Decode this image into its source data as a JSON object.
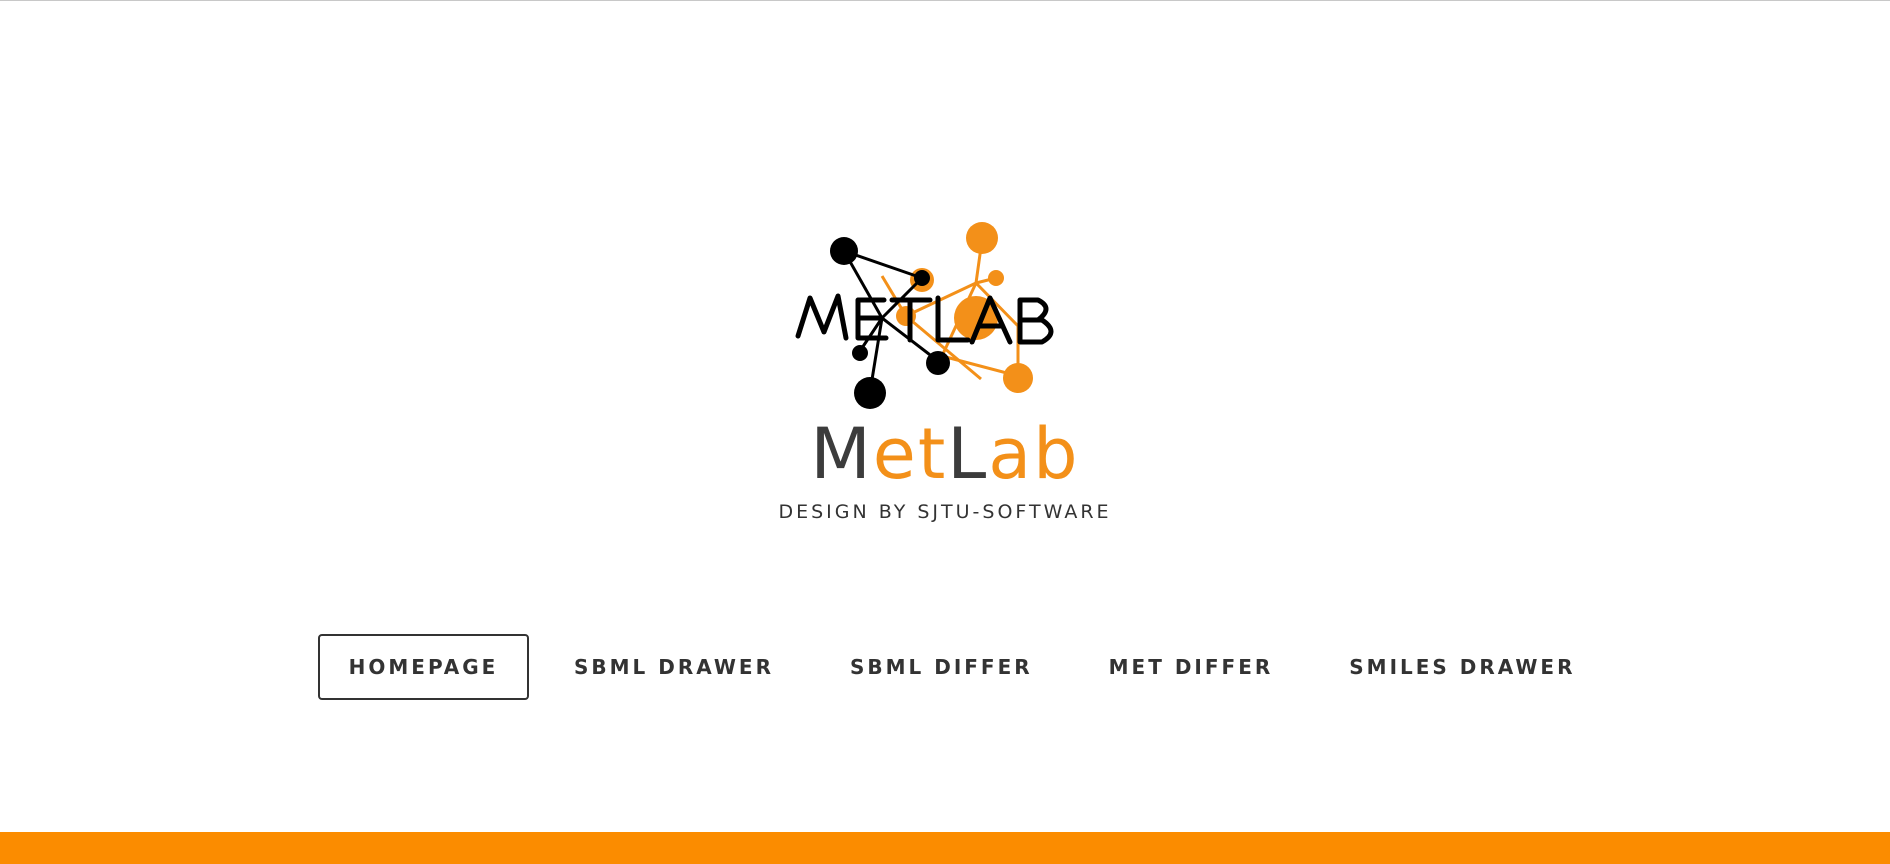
{
  "logo": {
    "image_text": "METLAB",
    "icon": "molecule-network-logo"
  },
  "brand": {
    "part1": "M",
    "part2": "et",
    "part3": "L",
    "part4": "ab"
  },
  "tagline": "DESIGN BY SJTU-SOFTWARE",
  "nav": {
    "items": [
      {
        "label": "HOMEPAGE",
        "active": true
      },
      {
        "label": "SBML DRAWER",
        "active": false
      },
      {
        "label": "SBML DIFFER",
        "active": false
      },
      {
        "label": "MET DIFFER",
        "active": false
      },
      {
        "label": "SMILES DRAWER",
        "active": false
      }
    ]
  },
  "colors": {
    "accent": "#f39019",
    "footer": "#fb8c00",
    "dark": "#3c3c3c"
  }
}
